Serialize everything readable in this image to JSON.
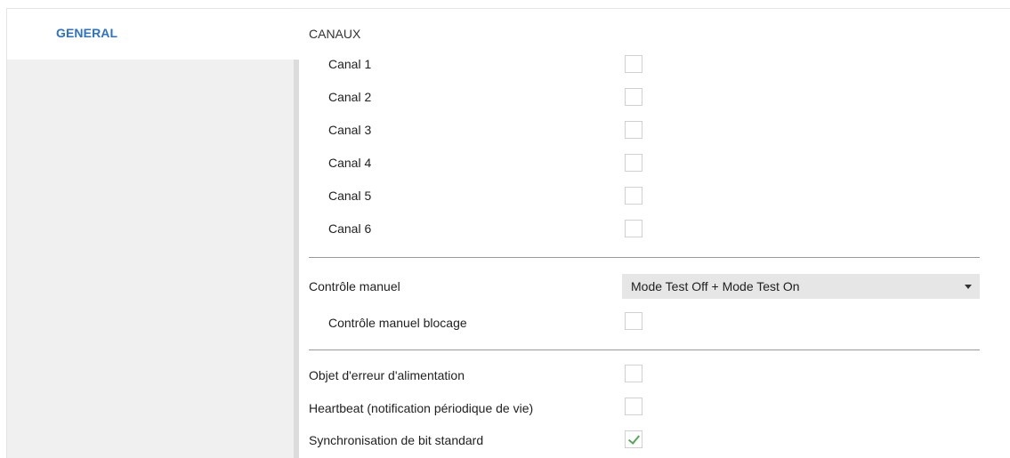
{
  "sidebar": {
    "tabs": [
      {
        "label": "GENERAL"
      }
    ]
  },
  "main": {
    "section_title": "CANAUX",
    "channels": [
      {
        "label": "Canal 1",
        "checked": false
      },
      {
        "label": "Canal 2",
        "checked": false
      },
      {
        "label": "Canal 3",
        "checked": false
      },
      {
        "label": "Canal 4",
        "checked": false
      },
      {
        "label": "Canal 5",
        "checked": false
      },
      {
        "label": "Canal 6",
        "checked": false
      }
    ],
    "manual_control": {
      "label": "Contrôle manuel",
      "selected": "Mode Test Off + Mode Test On"
    },
    "manual_lock": {
      "label": "Contrôle manuel blocage",
      "checked": false
    },
    "options": [
      {
        "label": "Objet d'erreur d'alimentation",
        "checked": false
      },
      {
        "label": "Heartbeat (notification périodique de vie)",
        "checked": false
      },
      {
        "label": "Synchronisation de bit standard",
        "checked": true
      }
    ]
  },
  "colors": {
    "accent": "#2c72c7",
    "check": "#5aa55a",
    "sidebar_bg": "#f0f0f0"
  }
}
